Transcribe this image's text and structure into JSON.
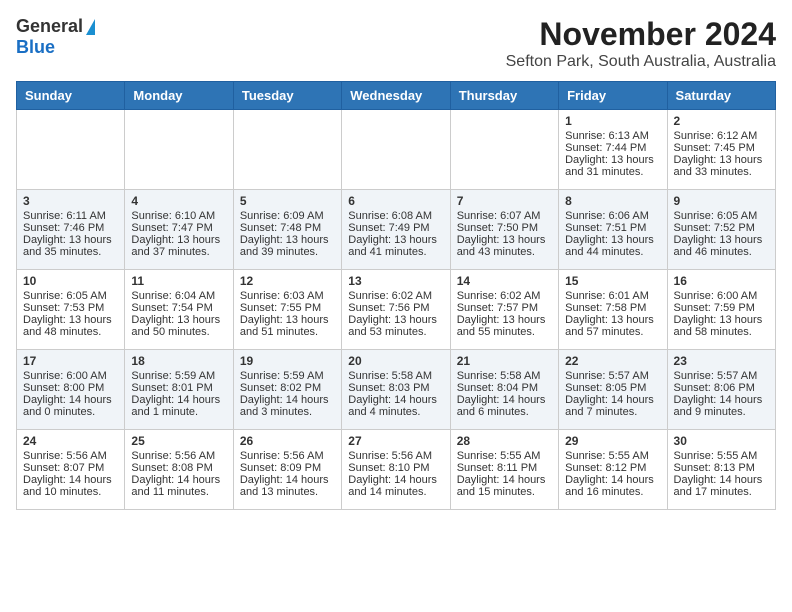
{
  "header": {
    "title": "November 2024",
    "subtitle": "Sefton Park, South Australia, Australia",
    "logo_line1": "General",
    "logo_line2": "Blue"
  },
  "days_of_week": [
    "Sunday",
    "Monday",
    "Tuesday",
    "Wednesday",
    "Thursday",
    "Friday",
    "Saturday"
  ],
  "weeks": [
    [
      {
        "day": "",
        "content": ""
      },
      {
        "day": "",
        "content": ""
      },
      {
        "day": "",
        "content": ""
      },
      {
        "day": "",
        "content": ""
      },
      {
        "day": "",
        "content": ""
      },
      {
        "day": "1",
        "content": "Sunrise: 6:13 AM\nSunset: 7:44 PM\nDaylight: 13 hours and 31 minutes."
      },
      {
        "day": "2",
        "content": "Sunrise: 6:12 AM\nSunset: 7:45 PM\nDaylight: 13 hours and 33 minutes."
      }
    ],
    [
      {
        "day": "3",
        "content": "Sunrise: 6:11 AM\nSunset: 7:46 PM\nDaylight: 13 hours and 35 minutes."
      },
      {
        "day": "4",
        "content": "Sunrise: 6:10 AM\nSunset: 7:47 PM\nDaylight: 13 hours and 37 minutes."
      },
      {
        "day": "5",
        "content": "Sunrise: 6:09 AM\nSunset: 7:48 PM\nDaylight: 13 hours and 39 minutes."
      },
      {
        "day": "6",
        "content": "Sunrise: 6:08 AM\nSunset: 7:49 PM\nDaylight: 13 hours and 41 minutes."
      },
      {
        "day": "7",
        "content": "Sunrise: 6:07 AM\nSunset: 7:50 PM\nDaylight: 13 hours and 43 minutes."
      },
      {
        "day": "8",
        "content": "Sunrise: 6:06 AM\nSunset: 7:51 PM\nDaylight: 13 hours and 44 minutes."
      },
      {
        "day": "9",
        "content": "Sunrise: 6:05 AM\nSunset: 7:52 PM\nDaylight: 13 hours and 46 minutes."
      }
    ],
    [
      {
        "day": "10",
        "content": "Sunrise: 6:05 AM\nSunset: 7:53 PM\nDaylight: 13 hours and 48 minutes."
      },
      {
        "day": "11",
        "content": "Sunrise: 6:04 AM\nSunset: 7:54 PM\nDaylight: 13 hours and 50 minutes."
      },
      {
        "day": "12",
        "content": "Sunrise: 6:03 AM\nSunset: 7:55 PM\nDaylight: 13 hours and 51 minutes."
      },
      {
        "day": "13",
        "content": "Sunrise: 6:02 AM\nSunset: 7:56 PM\nDaylight: 13 hours and 53 minutes."
      },
      {
        "day": "14",
        "content": "Sunrise: 6:02 AM\nSunset: 7:57 PM\nDaylight: 13 hours and 55 minutes."
      },
      {
        "day": "15",
        "content": "Sunrise: 6:01 AM\nSunset: 7:58 PM\nDaylight: 13 hours and 57 minutes."
      },
      {
        "day": "16",
        "content": "Sunrise: 6:00 AM\nSunset: 7:59 PM\nDaylight: 13 hours and 58 minutes."
      }
    ],
    [
      {
        "day": "17",
        "content": "Sunrise: 6:00 AM\nSunset: 8:00 PM\nDaylight: 14 hours and 0 minutes."
      },
      {
        "day": "18",
        "content": "Sunrise: 5:59 AM\nSunset: 8:01 PM\nDaylight: 14 hours and 1 minute."
      },
      {
        "day": "19",
        "content": "Sunrise: 5:59 AM\nSunset: 8:02 PM\nDaylight: 14 hours and 3 minutes."
      },
      {
        "day": "20",
        "content": "Sunrise: 5:58 AM\nSunset: 8:03 PM\nDaylight: 14 hours and 4 minutes."
      },
      {
        "day": "21",
        "content": "Sunrise: 5:58 AM\nSunset: 8:04 PM\nDaylight: 14 hours and 6 minutes."
      },
      {
        "day": "22",
        "content": "Sunrise: 5:57 AM\nSunset: 8:05 PM\nDaylight: 14 hours and 7 minutes."
      },
      {
        "day": "23",
        "content": "Sunrise: 5:57 AM\nSunset: 8:06 PM\nDaylight: 14 hours and 9 minutes."
      }
    ],
    [
      {
        "day": "24",
        "content": "Sunrise: 5:56 AM\nSunset: 8:07 PM\nDaylight: 14 hours and 10 minutes."
      },
      {
        "day": "25",
        "content": "Sunrise: 5:56 AM\nSunset: 8:08 PM\nDaylight: 14 hours and 11 minutes."
      },
      {
        "day": "26",
        "content": "Sunrise: 5:56 AM\nSunset: 8:09 PM\nDaylight: 14 hours and 13 minutes."
      },
      {
        "day": "27",
        "content": "Sunrise: 5:56 AM\nSunset: 8:10 PM\nDaylight: 14 hours and 14 minutes."
      },
      {
        "day": "28",
        "content": "Sunrise: 5:55 AM\nSunset: 8:11 PM\nDaylight: 14 hours and 15 minutes."
      },
      {
        "day": "29",
        "content": "Sunrise: 5:55 AM\nSunset: 8:12 PM\nDaylight: 14 hours and 16 minutes."
      },
      {
        "day": "30",
        "content": "Sunrise: 5:55 AM\nSunset: 8:13 PM\nDaylight: 14 hours and 17 minutes."
      }
    ]
  ]
}
